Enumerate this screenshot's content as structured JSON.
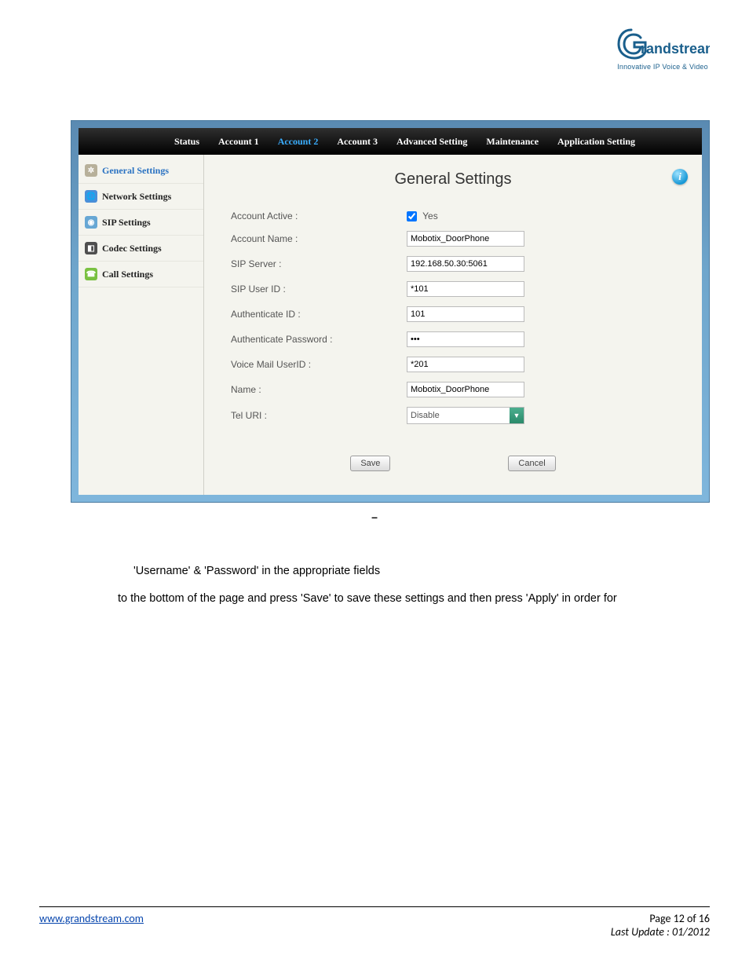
{
  "logo": {
    "brand": "Grandstream",
    "tagline": "Innovative IP Voice & Video"
  },
  "nav": {
    "items": [
      {
        "label": "Status",
        "active": false
      },
      {
        "label": "Account 1",
        "active": false
      },
      {
        "label": "Account 2",
        "active": true
      },
      {
        "label": "Account 3",
        "active": false
      },
      {
        "label": "Advanced Setting",
        "active": false
      },
      {
        "label": "Maintenance",
        "active": false
      },
      {
        "label": "Application Setting",
        "active": false
      }
    ]
  },
  "sidebar": {
    "items": [
      {
        "label": "General Settings",
        "selected": true
      },
      {
        "label": "Network Settings",
        "selected": false
      },
      {
        "label": "SIP Settings",
        "selected": false
      },
      {
        "label": "Codec Settings",
        "selected": false
      },
      {
        "label": "Call Settings",
        "selected": false
      }
    ]
  },
  "panel": {
    "title": "General Settings",
    "fields": {
      "account_active_label": "Account Active :",
      "account_active_value": "Yes",
      "account_name_label": "Account Name :",
      "account_name_value": "Mobotix_DoorPhone",
      "sip_server_label": "SIP Server :",
      "sip_server_value": "192.168.50.30:5061",
      "sip_user_id_label": "SIP User ID :",
      "sip_user_id_value": "*101",
      "auth_id_label": "Authenticate ID :",
      "auth_id_value": "101",
      "auth_pw_label": "Authenticate Password :",
      "auth_pw_value": "•••",
      "vm_userid_label": "Voice Mail UserID :",
      "vm_userid_value": "*201",
      "name_label": "Name :",
      "name_value": "Mobotix_DoorPhone",
      "tel_uri_label": "Tel URI :",
      "tel_uri_value": "Disable"
    },
    "buttons": {
      "save": "Save",
      "cancel": "Cancel"
    }
  },
  "caption": "–",
  "body": {
    "line1": "'Username' & 'Password' in the appropriate fields",
    "line2": "to the bottom of the page and press 'Save' to save these settings and then press 'Apply' in order for"
  },
  "footer": {
    "link": "www.grandstream.com",
    "page": "Page 12 of 16",
    "updated": "Last Update : 01/2012"
  }
}
